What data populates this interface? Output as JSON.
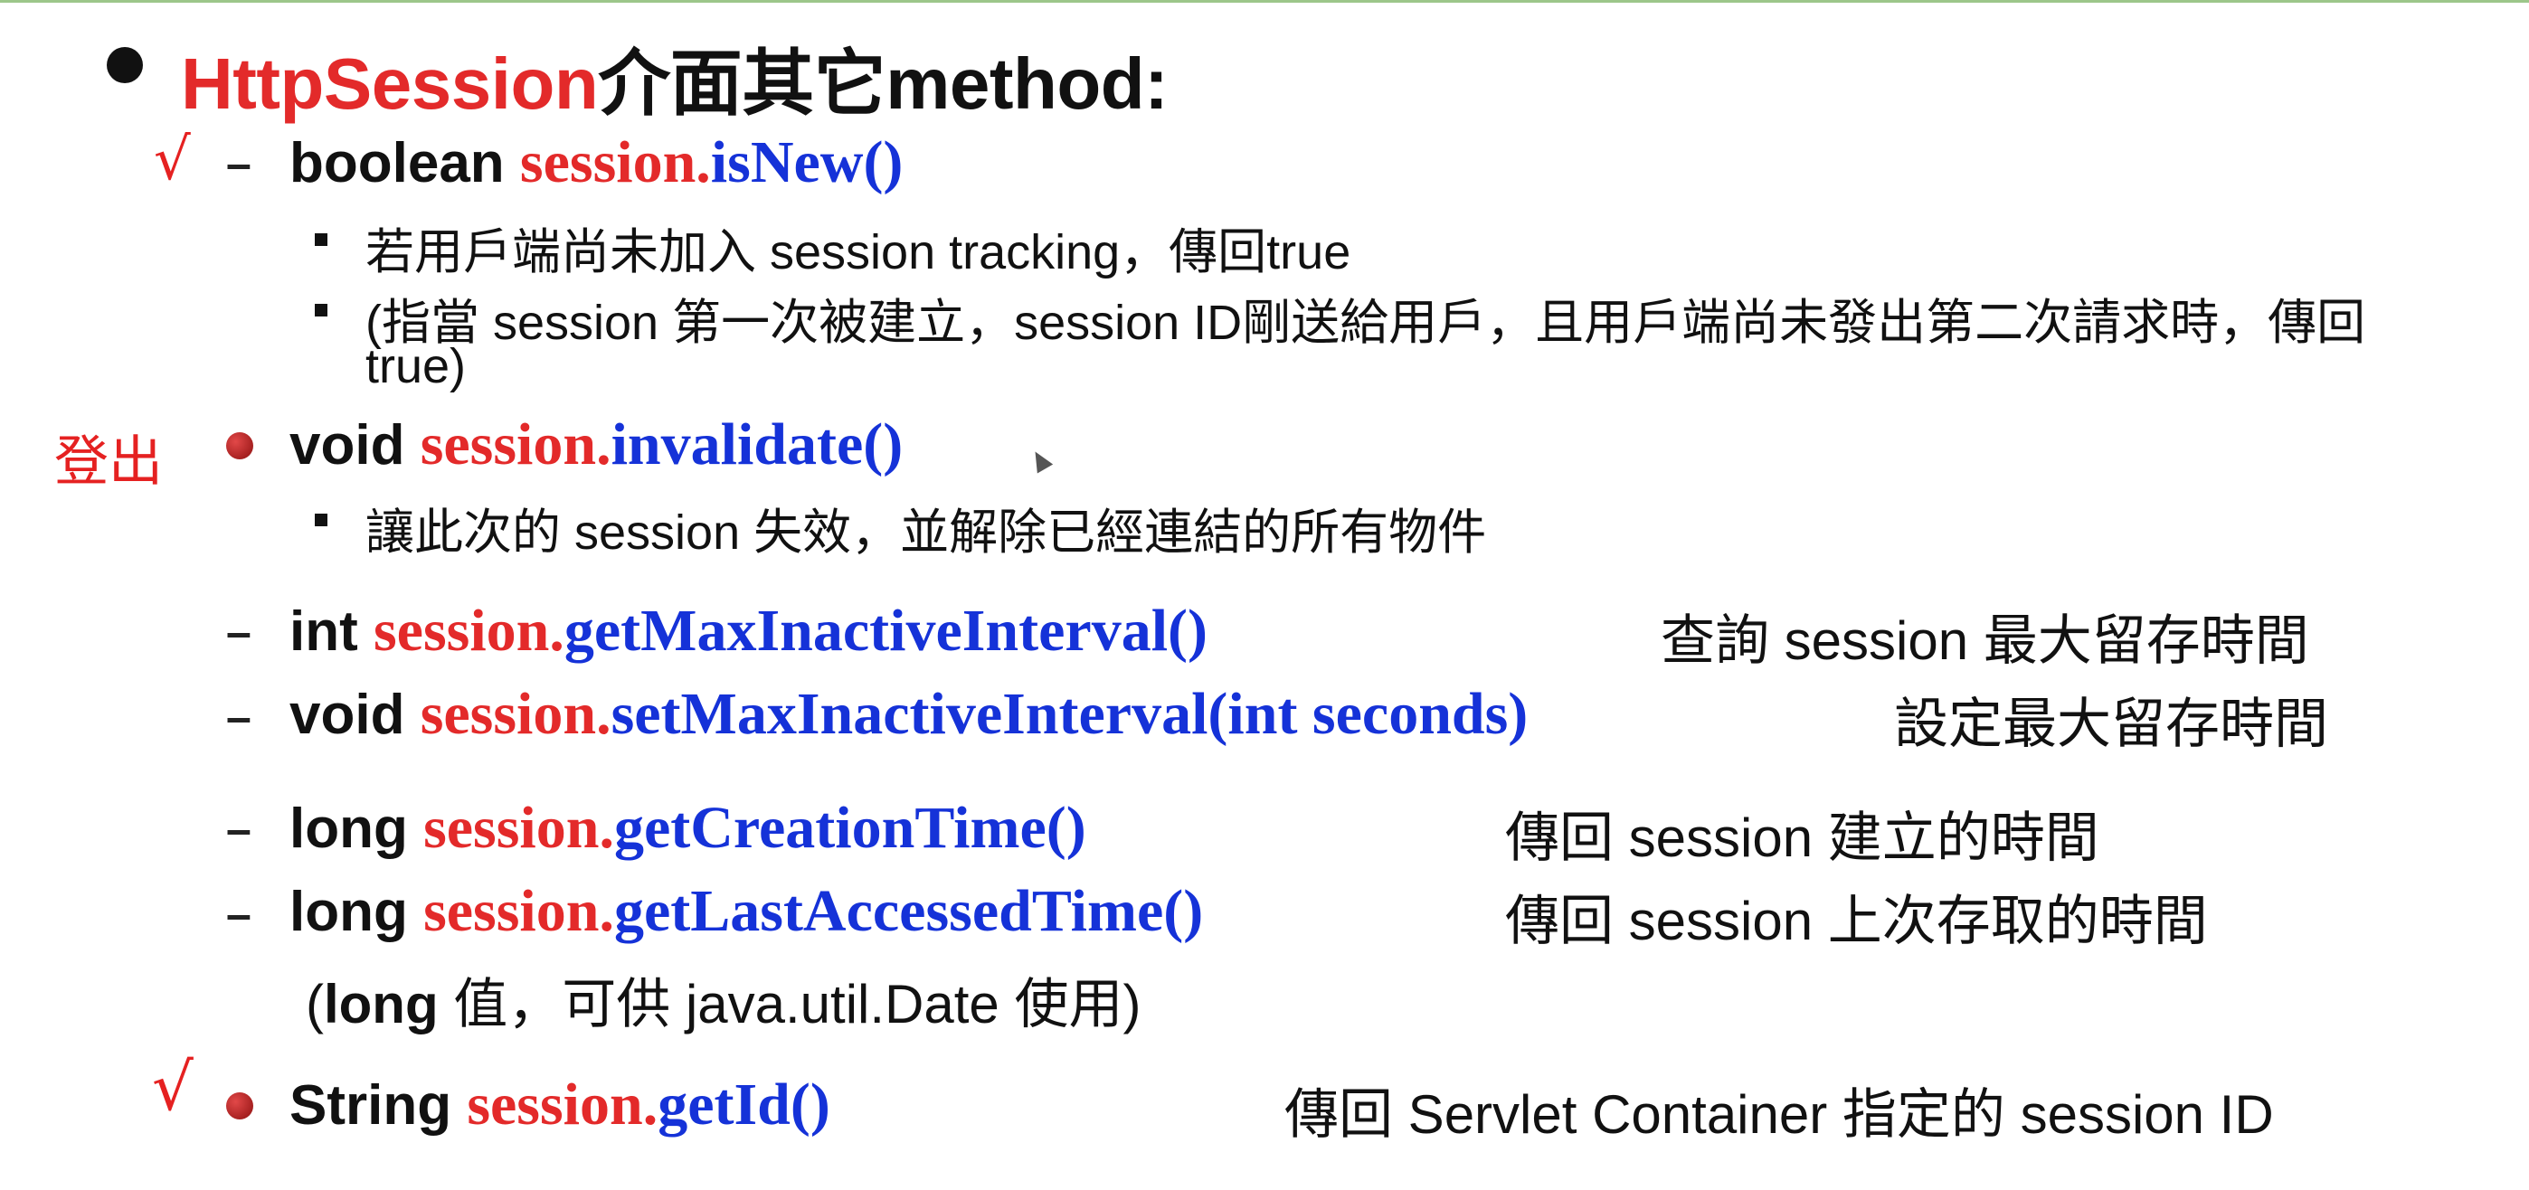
{
  "title": {
    "prefix": "HttpSession",
    "suffix": "介面其它method:"
  },
  "annotations": {
    "check1": "√",
    "logout": "登出",
    "check2": "√"
  },
  "items": [
    {
      "type": "boolean ",
      "obj": "session.",
      "method": "isNew()",
      "subs": [
        "若用戶端尚未加入 session tracking，傳回true",
        "(指當 session 第一次被建立，session ID剛送給用戶，且用戶端尚未發出第二次請求時，傳回",
        "true)"
      ]
    },
    {
      "type": "void ",
      "obj": "session.",
      "method": "invalidate()",
      "subs": [
        "讓此次的 session 失效，並解除已經連結的所有物件"
      ]
    },
    {
      "type": "int ",
      "obj": "session.",
      "method": "getMaxInactiveInterval()",
      "desc": "查詢 session 最大留存時間"
    },
    {
      "type": "void ",
      "obj": "session.",
      "method": "setMaxInactiveInterval(int seconds)",
      "desc": "設定最大留存時間"
    },
    {
      "type": "long ",
      "obj": "session.",
      "method": "getCreationTime()",
      "desc": "傳回 session 建立的時間"
    },
    {
      "type": "long ",
      "obj": "session.",
      "method": "getLastAccessedTime()",
      "desc": "傳回 session 上次存取的時間"
    },
    {
      "type": "String ",
      "obj": "session.",
      "method": "getId()",
      "desc": "傳回 Servlet Container 指定的 session ID"
    }
  ],
  "note": {
    "open": "(",
    "bold": "long",
    "rest": " 值，可供 java.util.Date 使用)"
  },
  "colors": {
    "object": "#e32a2a",
    "method": "#1532d8",
    "annotation": "#e52121"
  }
}
